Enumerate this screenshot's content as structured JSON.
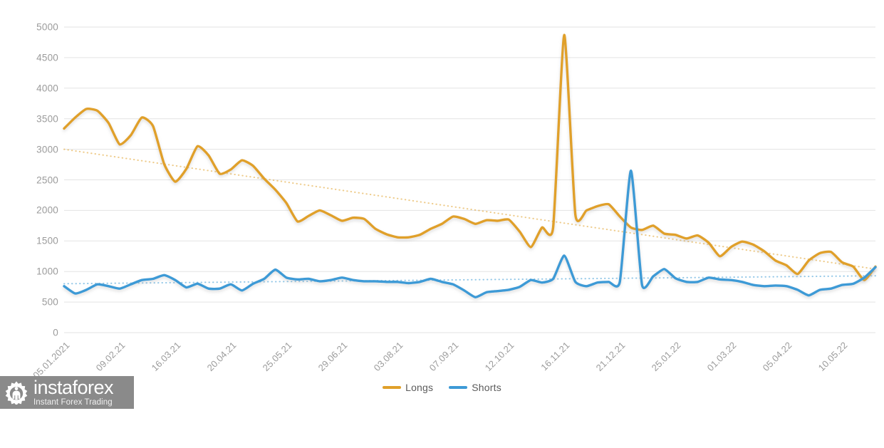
{
  "legend": {
    "position": "bottom-center",
    "items": [
      {
        "label": "Longs",
        "color": "#e0a02a",
        "name": "legend-longs"
      },
      {
        "label": "Shorts",
        "color": "#3d9ad6",
        "name": "legend-shorts"
      }
    ]
  },
  "watermark": {
    "title": "instaforex",
    "subtitle": "Instant Forex Trading",
    "background": "#8a8a8a"
  },
  "chart_data": {
    "type": "line",
    "title": "",
    "subtitle": "",
    "xlabel": "",
    "ylabel": "",
    "grid": true,
    "ylim": [
      0,
      5000
    ],
    "yticks": [
      0,
      500,
      1000,
      1500,
      2000,
      2500,
      3000,
      3500,
      4000,
      4500,
      5000
    ],
    "ytick_labels": [
      "0",
      "500",
      "1000",
      "1500",
      "2000",
      "2500",
      "3000",
      "3500",
      "4000",
      "4500",
      "5000"
    ],
    "xtick_labels": [
      "05.01.2021",
      "09.02.21",
      "16.03.21",
      "20.04.21",
      "25.05.21",
      "29.06.21",
      "03.08.21",
      "07.09.21",
      "12.10.21",
      "16.11.21",
      "21.12.21",
      "25.01.22",
      "01.03.22",
      "05.04.22",
      "10.05.22"
    ],
    "xtick_indices": [
      0,
      5,
      10,
      15,
      20,
      25,
      30,
      35,
      40,
      45,
      50,
      55,
      60,
      65,
      70
    ],
    "n_points": 74,
    "colors": {
      "longs": "#e0a02a",
      "shorts": "#3d9ad6",
      "grid": "#e3e3e3",
      "axis_text": "#9b9b9b"
    },
    "series": [
      {
        "name": "Longs",
        "color": "#e0a02a",
        "values": [
          3340,
          3520,
          3660,
          3630,
          3430,
          3080,
          3230,
          3520,
          3380,
          2760,
          2470,
          2680,
          3050,
          2900,
          2600,
          2670,
          2820,
          2730,
          2520,
          2340,
          2120,
          1820,
          1910,
          2000,
          1920,
          1830,
          1880,
          1860,
          1700,
          1610,
          1560,
          1560,
          1600,
          1700,
          1780,
          1900,
          1860,
          1780,
          1840,
          1830,
          1850,
          1650,
          1400,
          1720,
          1720,
          4870,
          1930,
          2000,
          2070,
          2100,
          1900,
          1720,
          1680,
          1750,
          1620,
          1600,
          1540,
          1590,
          1470,
          1250,
          1400,
          1490,
          1440,
          1330,
          1180,
          1100,
          960,
          1180,
          1300,
          1320,
          1150,
          1080,
          860,
          1080
        ]
      },
      {
        "name": "Shorts",
        "color": "#3d9ad6",
        "values": [
          760,
          640,
          700,
          790,
          760,
          720,
          790,
          860,
          880,
          940,
          860,
          740,
          800,
          720,
          720,
          790,
          690,
          800,
          880,
          1030,
          900,
          870,
          880,
          840,
          860,
          900,
          860,
          840,
          840,
          830,
          830,
          810,
          830,
          880,
          830,
          790,
          690,
          580,
          660,
          680,
          700,
          750,
          860,
          820,
          880,
          1260,
          830,
          760,
          820,
          830,
          830,
          2650,
          780,
          920,
          1040,
          890,
          830,
          830,
          900,
          870,
          860,
          830,
          780,
          760,
          770,
          760,
          700,
          610,
          700,
          720,
          780,
          800,
          900,
          1070
        ]
      }
    ],
    "trendlines": [
      {
        "name": "Longs trend",
        "style": "dotted",
        "color": "#e0a02a",
        "start_value": 3000,
        "end_value": 1040
      },
      {
        "name": "Shorts trend",
        "style": "dotted",
        "color": "#3d9ad6",
        "start_value": 800,
        "end_value": 930
      }
    ]
  }
}
